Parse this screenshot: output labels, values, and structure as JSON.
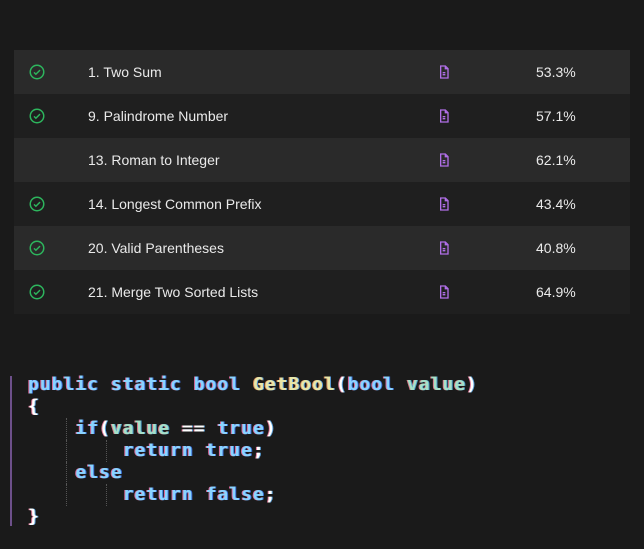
{
  "problems": [
    {
      "solved": true,
      "number": "1",
      "title": "Two Sum",
      "acceptance": "53.3%"
    },
    {
      "solved": true,
      "number": "9",
      "title": "Palindrome Number",
      "acceptance": "57.1%"
    },
    {
      "solved": false,
      "number": "13",
      "title": "Roman to Integer",
      "acceptance": "62.1%"
    },
    {
      "solved": true,
      "number": "14",
      "title": "Longest Common Prefix",
      "acceptance": "43.4%"
    },
    {
      "solved": true,
      "number": "20",
      "title": "Valid Parentheses",
      "acceptance": "40.8%"
    },
    {
      "solved": true,
      "number": "21",
      "title": "Merge Two Sorted Lists",
      "acceptance": "64.9%"
    }
  ],
  "code": {
    "tokens": [
      [
        {
          "t": "public",
          "k": "kw"
        },
        {
          "t": " ",
          "k": "sp"
        },
        {
          "t": "static",
          "k": "kw"
        },
        {
          "t": " ",
          "k": "sp"
        },
        {
          "t": "bool",
          "k": "kw"
        },
        {
          "t": " ",
          "k": "sp"
        },
        {
          "t": "GetBool",
          "k": "fn"
        },
        {
          "t": "(",
          "k": "pn"
        },
        {
          "t": "bool",
          "k": "kw"
        },
        {
          "t": " ",
          "k": "sp"
        },
        {
          "t": "value",
          "k": "lit"
        },
        {
          "t": ")",
          "k": "pn"
        }
      ],
      [
        {
          "t": "{",
          "k": "pn"
        }
      ],
      [
        {
          "t": "    ",
          "k": "sp"
        },
        {
          "t": "if",
          "k": "kw"
        },
        {
          "t": "(",
          "k": "pn"
        },
        {
          "t": "value",
          "k": "lit"
        },
        {
          "t": " ",
          "k": "sp"
        },
        {
          "t": "==",
          "k": "pn"
        },
        {
          "t": " ",
          "k": "sp"
        },
        {
          "t": "true",
          "k": "kw"
        },
        {
          "t": ")",
          "k": "pn"
        }
      ],
      [
        {
          "t": "        ",
          "k": "sp"
        },
        {
          "t": "return",
          "k": "kw"
        },
        {
          "t": " ",
          "k": "sp"
        },
        {
          "t": "true",
          "k": "kw"
        },
        {
          "t": ";",
          "k": "pn"
        }
      ],
      [
        {
          "t": "    ",
          "k": "sp"
        },
        {
          "t": "else",
          "k": "kw"
        }
      ],
      [
        {
          "t": "        ",
          "k": "sp"
        },
        {
          "t": "return",
          "k": "kw"
        },
        {
          "t": " ",
          "k": "sp"
        },
        {
          "t": "false",
          "k": "kw"
        },
        {
          "t": ";",
          "k": "pn"
        }
      ],
      [
        {
          "t": "}",
          "k": "pn"
        }
      ]
    ]
  }
}
